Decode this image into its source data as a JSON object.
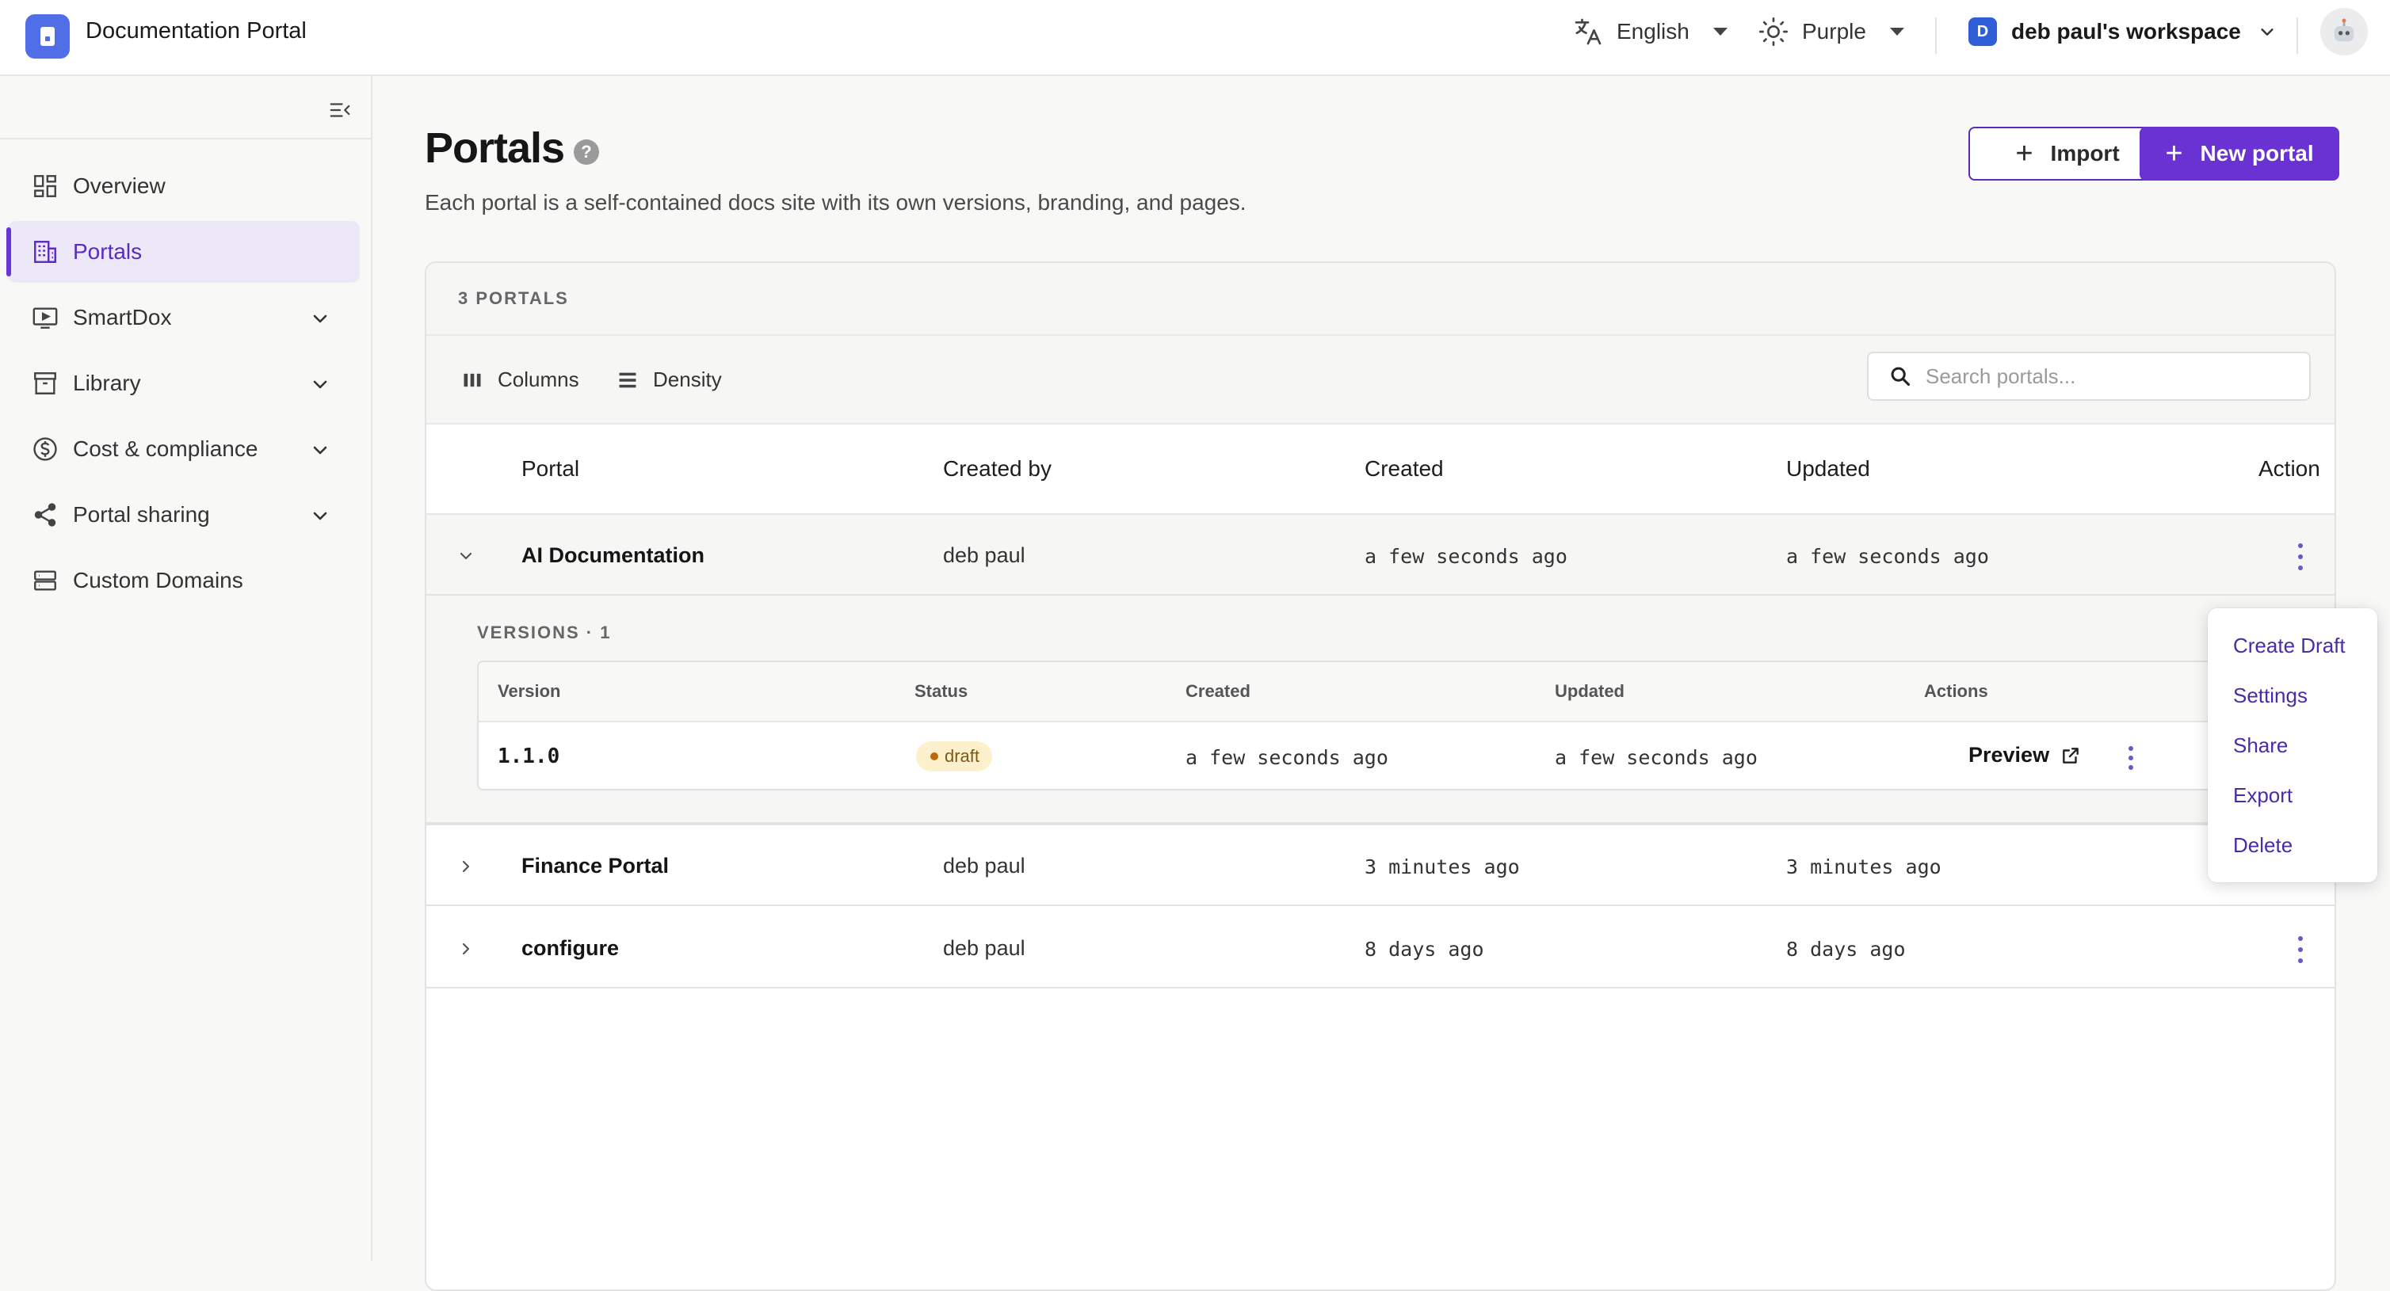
{
  "header": {
    "app_title": "Documentation Portal",
    "language": "English",
    "theme": "Purple",
    "workspace_initial": "D",
    "workspace": "deb paul's workspace"
  },
  "sidebar": {
    "items": [
      {
        "label": "Overview",
        "icon": "overview-grid-icon",
        "active": false,
        "expandable": false
      },
      {
        "label": "Portals",
        "icon": "building-icon",
        "active": true,
        "expandable": false
      },
      {
        "label": "SmartDox",
        "icon": "play-screen-icon",
        "active": false,
        "expandable": true
      },
      {
        "label": "Library",
        "icon": "archive-box-icon",
        "active": false,
        "expandable": true
      },
      {
        "label": "Cost & compliance",
        "icon": "dollar-circle-icon",
        "active": false,
        "expandable": true
      },
      {
        "label": "Portal sharing",
        "icon": "share-icon",
        "active": false,
        "expandable": true
      },
      {
        "label": "Custom Domains",
        "icon": "server-icon",
        "active": false,
        "expandable": false
      }
    ]
  },
  "page": {
    "title": "Portals",
    "subtitle": "Each portal is a self-contained docs site with its own versions, branding, and pages.",
    "import_label": "Import",
    "new_portal_label": "New portal"
  },
  "table": {
    "count_label": "3 PORTALS",
    "columns_label": "Columns",
    "density_label": "Density",
    "search_placeholder": "Search portals...",
    "headers": {
      "portal": "Portal",
      "created_by": "Created by",
      "created": "Created",
      "updated": "Updated",
      "action": "Action"
    },
    "rows": [
      {
        "portal": "AI Documentation",
        "created_by": "deb paul",
        "created": "a few seconds ago",
        "updated": "a few seconds ago",
        "expanded": true
      },
      {
        "portal": "Finance Portal",
        "created_by": "deb paul",
        "created": "3 minutes ago",
        "updated": "3 minutes ago",
        "expanded": false
      },
      {
        "portal": "configure",
        "created_by": "deb paul",
        "created": "8 days ago",
        "updated": "8 days ago",
        "expanded": false
      }
    ]
  },
  "versions": {
    "label": "VERSIONS · 1",
    "headers": {
      "version": "Version",
      "status": "Status",
      "created": "Created",
      "updated": "Updated",
      "actions": "Actions"
    },
    "rows": [
      {
        "version": "1.1.0",
        "status": "draft",
        "created": "a few seconds ago",
        "updated": "a few seconds ago",
        "preview_label": "Preview"
      }
    ]
  },
  "context_menu": {
    "items": [
      "Create Draft",
      "Settings",
      "Share",
      "Export",
      "Delete"
    ]
  },
  "colors": {
    "accent": "#6a32d2",
    "active_bg": "#ede8f7",
    "draft_badge_bg": "#fdf0cc"
  }
}
